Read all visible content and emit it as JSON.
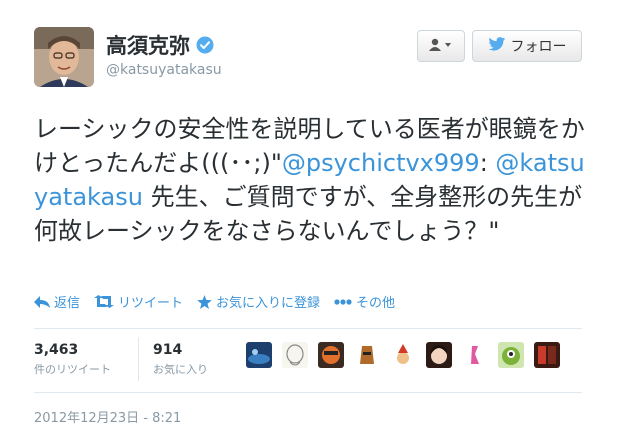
{
  "user": {
    "name": "高須克弥",
    "handle": "@katsuyatakasu",
    "verified": true
  },
  "buttons": {
    "user_menu_icon": "user-dropdown-icon",
    "follow_label": "フォロー"
  },
  "tweet": {
    "text_before_mention1": "レーシックの安全性を説明している医者が眼鏡をかけとったんだよ(((･･;)\"",
    "mention1": "@psychictvx999",
    "text_between": ": ",
    "mention2": "@katsuyatakasu",
    "text_after": " 先生、ご質問ですが、全身整形の先生が何故レーシックをなさらないんでしょう？\""
  },
  "actions": {
    "reply": "返信",
    "retweet": "リツイート",
    "favorite": "お気に入りに登録",
    "more": "その他"
  },
  "stats": {
    "retweets": {
      "count": "3,463",
      "label": "件のリツイート"
    },
    "favorites": {
      "count": "914",
      "label": "お気に入り"
    }
  },
  "timestamp": "2012年12月23日 - 8:21",
  "colors": {
    "link": "#3b94d9",
    "verified": "#55acee",
    "twitter_bird": "#55acee"
  }
}
